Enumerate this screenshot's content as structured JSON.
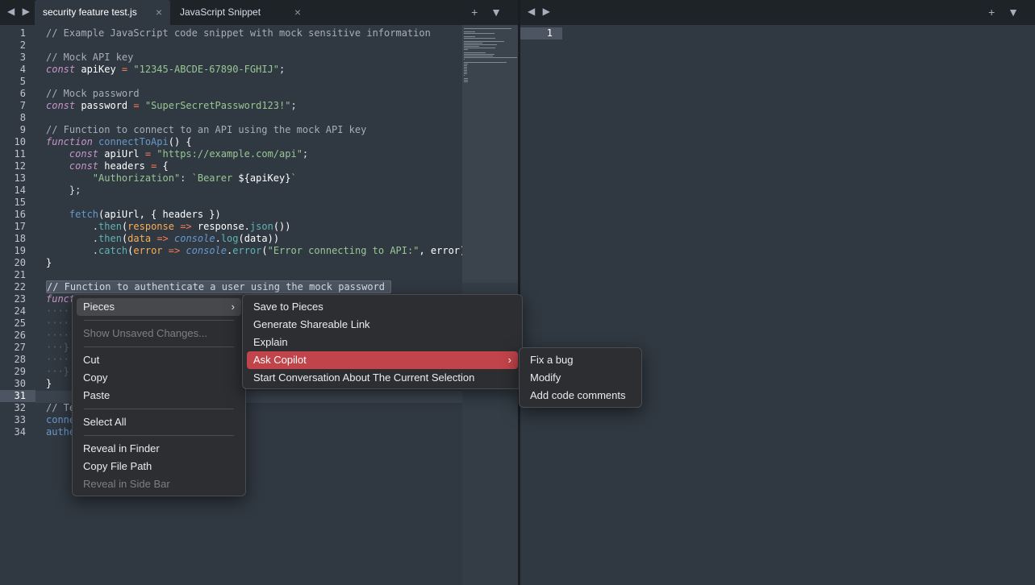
{
  "left_pane": {
    "tabs": [
      {
        "label": "security feature test.js",
        "active": true
      },
      {
        "label": "JavaScript Snippet",
        "active": false
      }
    ],
    "close_glyph": "×",
    "nav_glyph": "◀ ▶",
    "actions_glyph": "+ ▼"
  },
  "right_pane": {
    "nav_glyph": "◀ ▶",
    "actions_glyph": "+ ▼",
    "line_number": "1"
  },
  "editor": {
    "line_numbers": [
      "1",
      "2",
      "3",
      "4",
      "5",
      "6",
      "7",
      "8",
      "9",
      "10",
      "11",
      "12",
      "13",
      "14",
      "15",
      "16",
      "17",
      "18",
      "19",
      "20",
      "21",
      "22",
      "23",
      "24",
      "25",
      "26",
      "27",
      "28",
      "29",
      "30",
      "31",
      "32",
      "33",
      "34"
    ],
    "current_line": "31",
    "lines": [
      [
        [
          "cm",
          "// Example JavaScript code snippet with mock sensitive information"
        ]
      ],
      [],
      [
        [
          "cm",
          "// Mock API key"
        ]
      ],
      [
        [
          "kw",
          "const"
        ],
        [
          "wh",
          " apiKey "
        ],
        [
          "op",
          "="
        ],
        [
          "",
          " "
        ],
        [
          "st",
          "\"12345-ABCDE-67890-FGHIJ\""
        ],
        [
          "",
          "; "
        ]
      ],
      [],
      [
        [
          "cm",
          "// Mock password"
        ]
      ],
      [
        [
          "kw",
          "const"
        ],
        [
          "wh",
          " password "
        ],
        [
          "op",
          "="
        ],
        [
          "",
          " "
        ],
        [
          "st",
          "\"SuperSecretPassword123!\""
        ],
        [
          "",
          ";"
        ]
      ],
      [],
      [
        [
          "cm",
          "// Function to connect to an API using the mock API key"
        ]
      ],
      [
        [
          "kw",
          "function"
        ],
        [
          "",
          " "
        ],
        [
          "fn",
          "connectToApi"
        ],
        [
          "wh",
          "() {"
        ]
      ],
      [
        [
          "",
          "    "
        ],
        [
          "kw",
          "const"
        ],
        [
          "wh",
          " apiUrl "
        ],
        [
          "op",
          "="
        ],
        [
          "",
          " "
        ],
        [
          "st",
          "\"https://example.com/api\""
        ],
        [
          "",
          ";"
        ]
      ],
      [
        [
          "",
          "    "
        ],
        [
          "kw",
          "const"
        ],
        [
          "wh",
          " headers "
        ],
        [
          "op",
          "="
        ],
        [
          "wh",
          " {"
        ]
      ],
      [
        [
          "",
          "        "
        ],
        [
          "st",
          "\"Authorization\""
        ],
        [
          "",
          ": "
        ],
        [
          "st",
          "`Bearer "
        ],
        [
          "wh",
          "${apiKey}"
        ],
        [
          "st",
          "`"
        ]
      ],
      [
        [
          "",
          "    };"
        ]
      ],
      [],
      [
        [
          "",
          "    "
        ],
        [
          "fn",
          "fetch"
        ],
        [
          "wh",
          "(apiUrl, { headers })"
        ]
      ],
      [
        [
          "",
          "        ."
        ],
        [
          "pn",
          "then"
        ],
        [
          "wh",
          "("
        ],
        [
          "vr",
          "response"
        ],
        [
          "",
          " "
        ],
        [
          "op",
          "=>"
        ],
        [
          "wh",
          " response."
        ],
        [
          "pn",
          "json"
        ],
        [
          "wh",
          "())"
        ]
      ],
      [
        [
          "",
          "        ."
        ],
        [
          "pn",
          "then"
        ],
        [
          "wh",
          "("
        ],
        [
          "vr",
          "data"
        ],
        [
          "",
          " "
        ],
        [
          "op",
          "=>"
        ],
        [
          "",
          " "
        ],
        [
          "it",
          "console"
        ],
        [
          "wh",
          "."
        ],
        [
          "pn",
          "log"
        ],
        [
          "wh",
          "(data))"
        ]
      ],
      [
        [
          "",
          "        ."
        ],
        [
          "pn",
          "catch"
        ],
        [
          "wh",
          "("
        ],
        [
          "vr",
          "error"
        ],
        [
          "",
          " "
        ],
        [
          "op",
          "=>"
        ],
        [
          "",
          " "
        ],
        [
          "it",
          "console"
        ],
        [
          "wh",
          "."
        ],
        [
          "pn",
          "error"
        ],
        [
          "wh",
          "("
        ],
        [
          "st",
          "\"Error connecting to API:\""
        ],
        [
          "wh",
          ", error));"
        ]
      ],
      [
        [
          "wh",
          "}"
        ]
      ],
      [],
      [
        [
          "sel",
          "// Function to authenticate a user using the mock password "
        ]
      ],
      [
        [
          "kw",
          "funct"
        ]
      ],
      [
        [
          "ws",
          "····"
        ]
      ],
      [
        [
          "ws",
          "····"
        ]
      ],
      [
        [
          "ws",
          "····"
        ]
      ],
      [
        [
          "ws",
          "···}"
        ]
      ],
      [
        [
          "ws",
          "····"
        ]
      ],
      [
        [
          "ws",
          "···}"
        ]
      ],
      [
        [
          "wh",
          "}"
        ]
      ],
      [],
      [
        [
          "cm",
          "// Te"
        ]
      ],
      [
        [
          "fn",
          "conne"
        ]
      ],
      [
        [
          "fn",
          "authe"
        ]
      ]
    ]
  },
  "context_menu": {
    "items": [
      {
        "label": "Pieces",
        "submenu": true,
        "state": "hover"
      },
      {
        "separator": true
      },
      {
        "label": "Show Unsaved Changes...",
        "state": "disabled"
      },
      {
        "separator": true
      },
      {
        "label": "Cut"
      },
      {
        "label": "Copy"
      },
      {
        "label": "Paste"
      },
      {
        "separator": true
      },
      {
        "label": "Select All"
      },
      {
        "separator": true
      },
      {
        "label": "Reveal in Finder"
      },
      {
        "label": "Copy File Path"
      },
      {
        "label": "Reveal in Side Bar",
        "state": "disabled"
      }
    ]
  },
  "pieces_menu": {
    "items": [
      {
        "label": "Save to Pieces"
      },
      {
        "label": "Generate Shareable Link"
      },
      {
        "label": "Explain"
      },
      {
        "label": "Ask Copilot",
        "submenu": true,
        "state": "active"
      },
      {
        "label": "Start Conversation About The Current Selection"
      }
    ]
  },
  "copilot_menu": {
    "items": [
      {
        "label": "Fix a bug"
      },
      {
        "label": "Modify"
      },
      {
        "label": "Add code comments"
      }
    ]
  },
  "submenu_arrow": "›",
  "colors": {
    "editor_bg": "#303841",
    "tabbar_bg": "#1e2328",
    "menu_bg": "#2c2e31",
    "menu_active": "#c0444a",
    "comment": "#a7adba",
    "keyword": "#c695c6",
    "string": "#99c794",
    "function": "#6699cc"
  }
}
